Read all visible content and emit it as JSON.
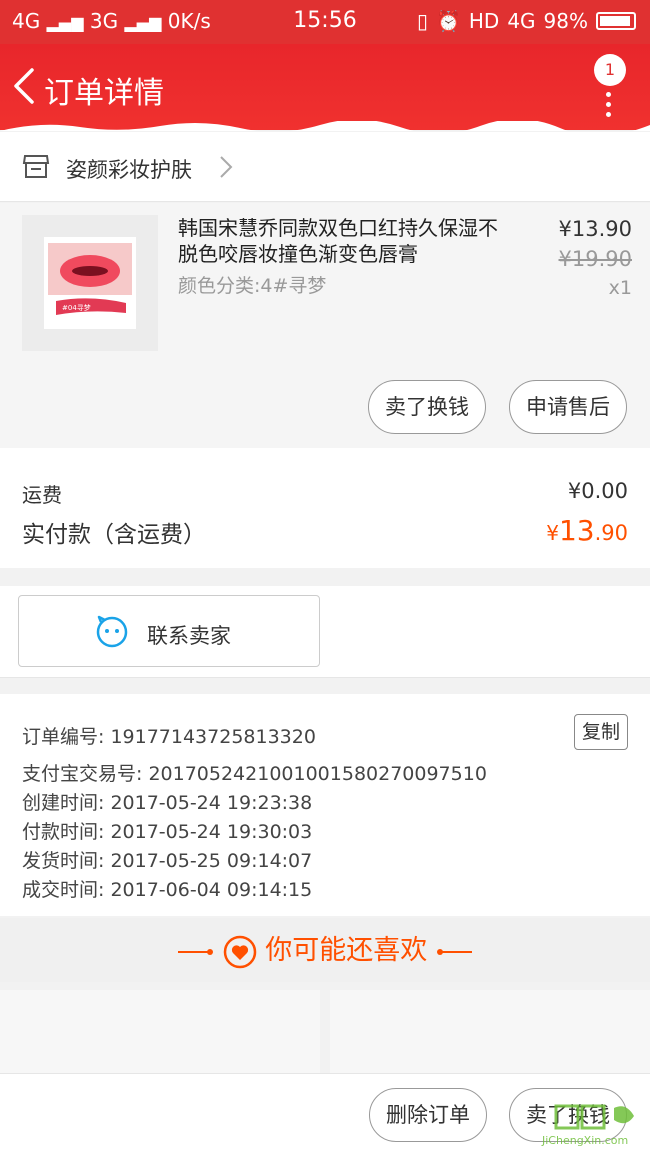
{
  "status_bar": {
    "network_left": "4G",
    "network_mid": "3G",
    "speed": "0K/s",
    "time": "15:56",
    "hd": "HD",
    "network_right": "4G",
    "battery": "98%"
  },
  "header": {
    "title": "订单详情",
    "badge_count": "1"
  },
  "shop": {
    "name": "姿颜彩妆护肤"
  },
  "product": {
    "title": "韩国宋慧乔同款双色口红持久保湿不脱色咬唇妆撞色渐变色唇膏",
    "attribute": "颜色分类:4#寻梦",
    "price": "¥13.90",
    "original_price": "¥19.90",
    "quantity": "x1",
    "thumb_caption": "#04寻梦",
    "sell_button": "卖了换钱",
    "after_sale_button": "申请售后"
  },
  "fees": {
    "shipping_label": "运费",
    "shipping_value": "¥0.00",
    "paid_label": "实付款（含运费）",
    "paid_currency": "¥",
    "paid_integer": "13",
    "paid_decimal": ".90"
  },
  "contact": {
    "label": "联系卖家"
  },
  "order_info": {
    "order_no": "订单编号: 19177143725813320",
    "alipay_no": "支付宝交易号: 2017052421001001580270097510",
    "created": "创建时间: 2017-05-24 19:23:38",
    "paid": "付款时间: 2017-05-24 19:30:03",
    "shipped": "发货时间: 2017-05-25 09:14:07",
    "completed": "成交时间: 2017-06-04 09:14:15",
    "copy_button": "复制"
  },
  "recommend": {
    "title": "你可能还喜欢"
  },
  "bottom_bar": {
    "delete_button": "删除订单",
    "sell_button": "卖了换钱"
  },
  "watermark": {
    "text": "JiChengXin.com"
  },
  "colors": {
    "header_red": "#e8262b",
    "accent_orange": "#ff5000"
  }
}
